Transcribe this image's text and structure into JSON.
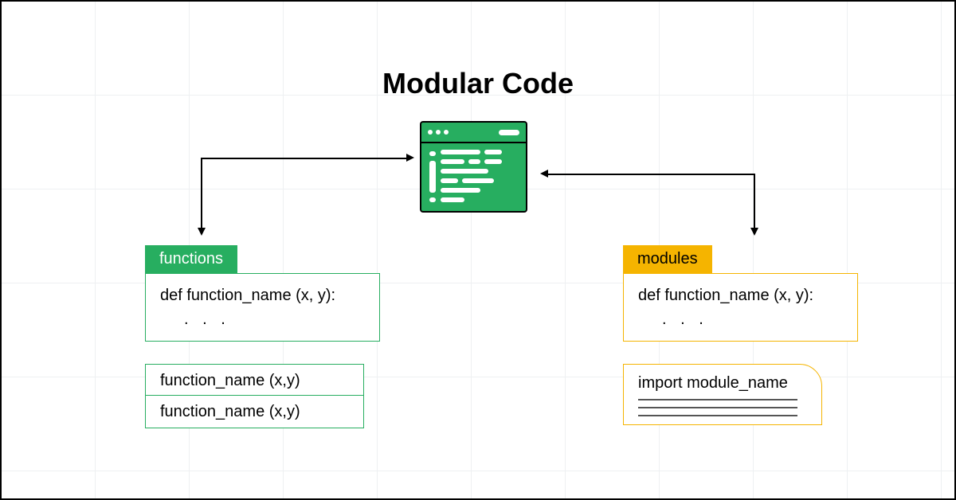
{
  "title": "Modular Code",
  "colors": {
    "green": "#27ae60",
    "yellow": "#f5b400"
  },
  "functions": {
    "tab_label": "functions",
    "def_line1": "def function_name (x, y):",
    "def_line2": ". . .",
    "call1": "function_name (x,y)",
    "call2": "function_name (x,y)"
  },
  "modules": {
    "tab_label": "modules",
    "def_line1": "def function_name (x, y):",
    "def_line2": ". . .",
    "import_line": "import module_name"
  }
}
